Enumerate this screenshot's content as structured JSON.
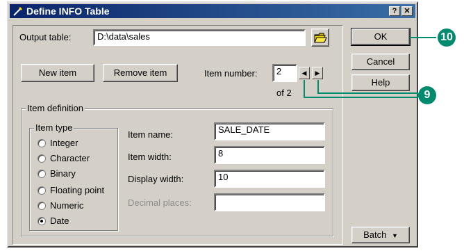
{
  "window": {
    "title": "Define INFO Table"
  },
  "titlebar": {
    "help_glyph": "?",
    "close_glyph": "✕"
  },
  "output": {
    "label": "Output table:",
    "value": "D:\\data\\sales"
  },
  "buttons": {
    "new_item": "New item",
    "remove_item": "Remove item",
    "ok": "OK",
    "cancel": "Cancel",
    "help": "Help",
    "batch": "Batch"
  },
  "item_number": {
    "label": "Item number:",
    "value": "2",
    "of": "of 2"
  },
  "item_definition": {
    "legend": "Item definition",
    "item_type_legend": "Item type",
    "types": [
      "Integer",
      "Character",
      "Binary",
      "Floating point",
      "Numeric",
      "Date"
    ],
    "selected_type": "Date",
    "name_label": "Item name:",
    "name_value": "SALE_DATE",
    "width_label": "Item width:",
    "width_value": "8",
    "display_label": "Display width:",
    "display_value": "10",
    "decimal_label": "Decimal places:",
    "decimal_value": ""
  },
  "callouts": {
    "ok_step": "10",
    "arrows_step": "9"
  },
  "colors": {
    "callout": "#008a6e",
    "titlebar": "#0a246a"
  }
}
